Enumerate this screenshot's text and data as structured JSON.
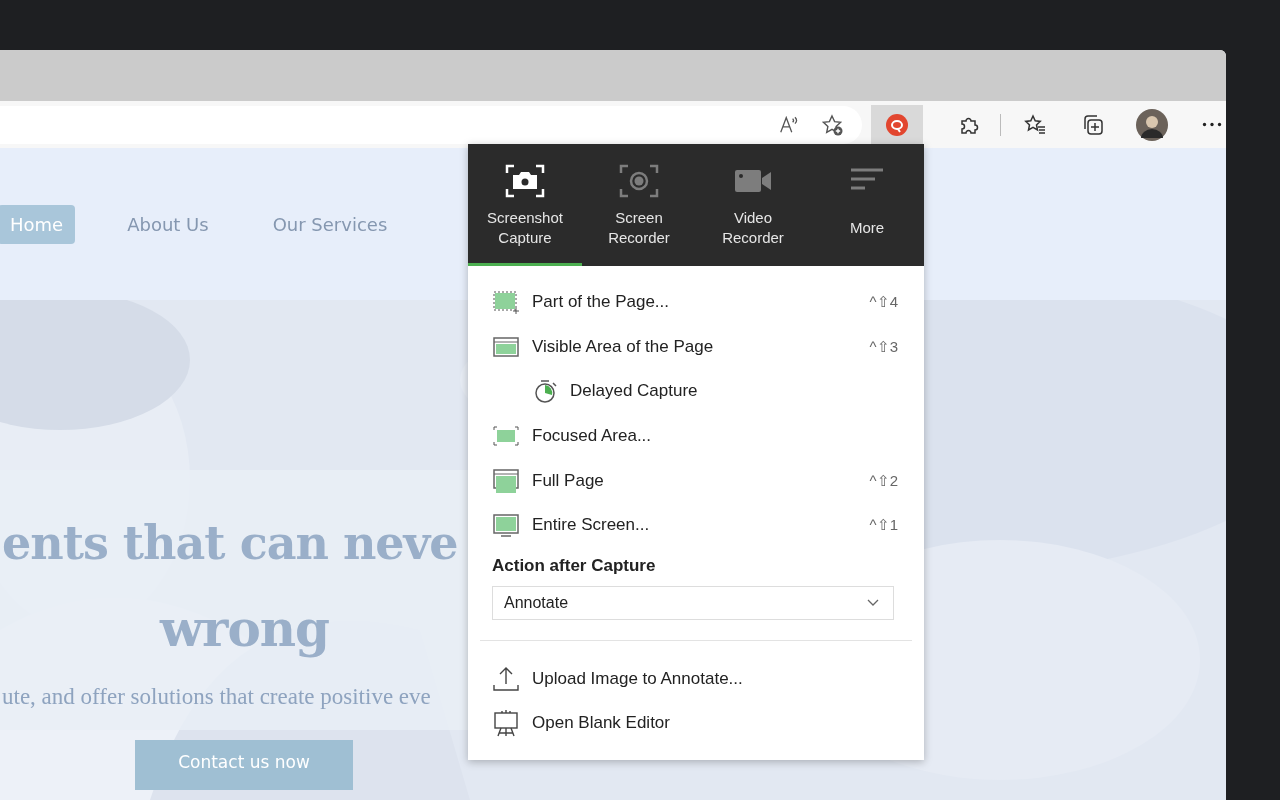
{
  "toolbar": {
    "extension_active": true
  },
  "site": {
    "nav": [
      {
        "label": "Home",
        "selected": true
      },
      {
        "label": "About Us",
        "selected": false
      },
      {
        "label": "Our Services",
        "selected": false
      }
    ],
    "hero": {
      "heading_lines": [
        "ents that can neve",
        "wrong"
      ],
      "text": "ute, and offer solutions that create positive eve",
      "button": "Contact us now"
    }
  },
  "popup": {
    "tabs": [
      {
        "kind": "screenshot",
        "label": "Screenshot Capture",
        "selected": true
      },
      {
        "kind": "screen",
        "label": "Screen Recorder",
        "selected": false
      },
      {
        "kind": "video",
        "label": "Video Recorder",
        "selected": false
      },
      {
        "kind": "more",
        "label": "More",
        "selected": false
      }
    ],
    "capture_items": [
      {
        "kind": "region",
        "label": "Part of the Page...",
        "shortcut": "^⇧4"
      },
      {
        "kind": "visible",
        "label": "Visible Area of the Page",
        "shortcut": "^⇧3",
        "children": [
          {
            "kind": "delayed",
            "label": "Delayed Capture"
          }
        ]
      },
      {
        "kind": "focused",
        "label": "Focused Area..."
      },
      {
        "kind": "fullpage",
        "label": "Full Page",
        "shortcut": "^⇧2"
      },
      {
        "kind": "screen",
        "label": "Entire Screen...",
        "shortcut": "^⇧1"
      }
    ],
    "action_label": "Action after Capture",
    "action_value": "Annotate",
    "extra_items": [
      {
        "kind": "upload",
        "label": "Upload Image to Annotate..."
      },
      {
        "kind": "editor",
        "label": "Open Blank Editor"
      }
    ]
  }
}
